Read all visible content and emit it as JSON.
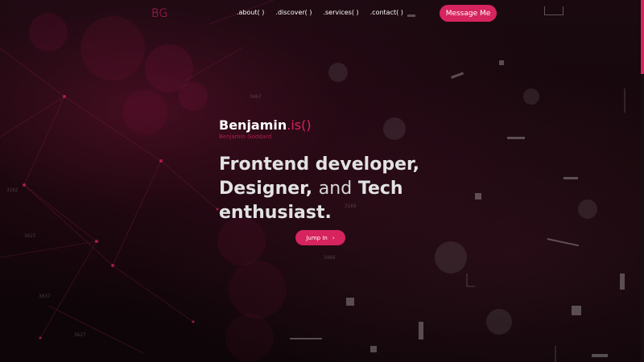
{
  "header": {
    "logo": "BG",
    "nav": [
      {
        "label": ".about( )"
      },
      {
        "label": ".discover( )"
      },
      {
        "label": ".services( )"
      },
      {
        "label": ".contact( )"
      }
    ],
    "cta_label": "Message Me"
  },
  "hero": {
    "name": "Benjamin",
    "name_suffix": ".is()",
    "subtitle": "Benjamin Goddard",
    "headline_part1": "Frontend developer,",
    "headline_part2": "Designer,",
    "headline_and": "and",
    "headline_part3": "Tech",
    "headline_part4": "enthusiast.",
    "button_label": "Jump In",
    "button_icon": "chevron-right-icon"
  },
  "background": {
    "numbers": [
      "3467",
      "3169",
      "3627",
      "3037",
      "3162",
      "3627",
      "3468"
    ]
  },
  "colors": {
    "accent": "#d6245f",
    "background": "#120609",
    "text": "#ffffff"
  }
}
